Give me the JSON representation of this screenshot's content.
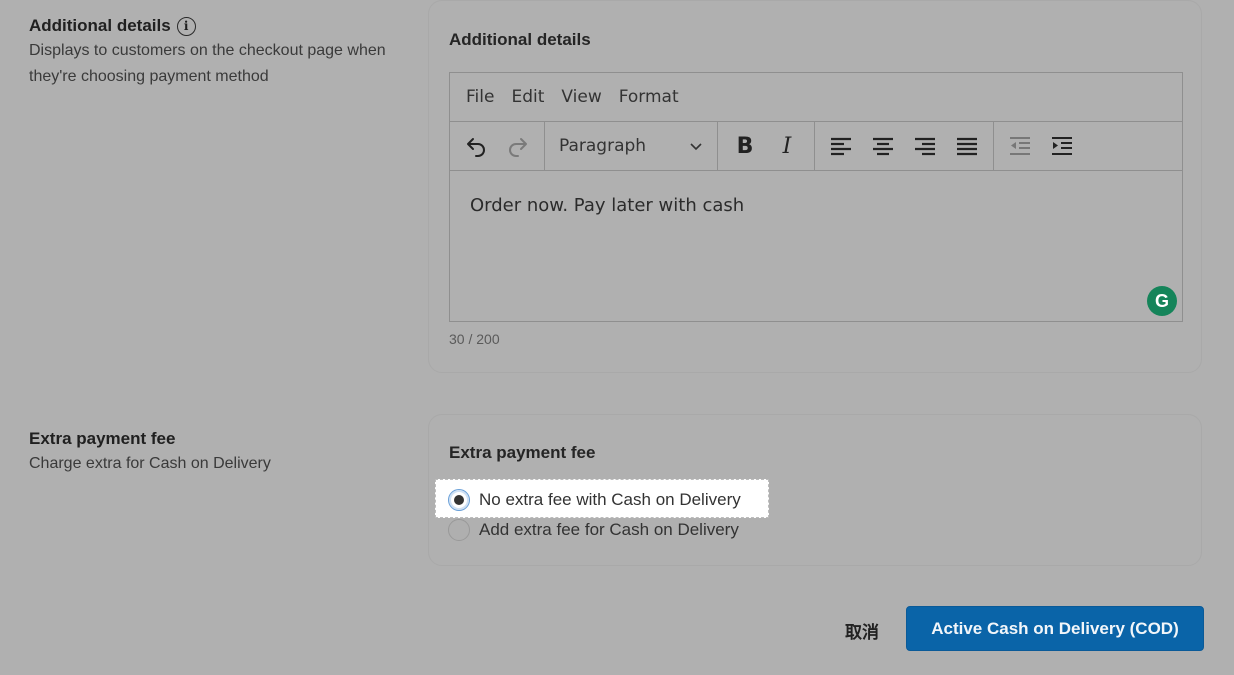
{
  "additional_details": {
    "title": "Additional details",
    "description": "Displays to customers on the checkout page when they're choosing payment method",
    "card_title": "Additional details",
    "menu": [
      "File",
      "Edit",
      "View",
      "Format"
    ],
    "block_format": "Paragraph",
    "content": "Order now. Pay later with cash",
    "char_count": "30 / 200",
    "grammarly_badge": "G"
  },
  "extra_fee": {
    "title": "Extra payment fee",
    "description": "Charge extra for Cash on Delivery",
    "card_title": "Extra payment fee",
    "options": [
      {
        "label": "No extra fee with Cash on Delivery",
        "checked": true
      },
      {
        "label": "Add extra fee for Cash on Delivery",
        "checked": false
      }
    ]
  },
  "footer": {
    "cancel_label": "取消",
    "submit_label": "Active Cash on Delivery (COD)"
  },
  "colors": {
    "primary": "#0a64a8",
    "overlay": "#b0b0b0",
    "grammarly": "#15845a"
  },
  "icons": [
    "info-icon",
    "undo-icon",
    "redo-icon",
    "chevron-down-icon",
    "bold-icon",
    "italic-icon",
    "align-left-icon",
    "align-center-icon",
    "align-right-icon",
    "align-justify-icon",
    "outdent-icon",
    "indent-icon",
    "grammarly-icon"
  ]
}
